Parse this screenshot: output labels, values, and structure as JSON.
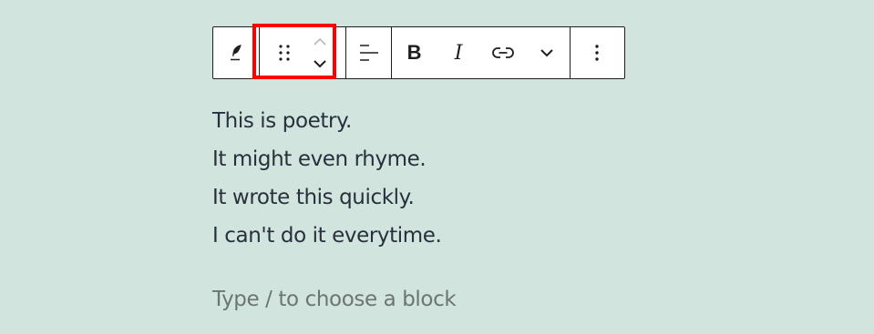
{
  "toolbar": {
    "block_type_icon": "verse-quill-icon",
    "drag_icon": "drag-handle-icon",
    "move_up_icon": "chevron-up-icon",
    "move_down_icon": "chevron-down-icon",
    "align_icon": "align-left-icon",
    "bold_label": "B",
    "italic_label": "I",
    "link_icon": "link-icon",
    "more_formats_icon": "chevron-down-icon",
    "options_icon": "more-vertical-icon"
  },
  "highlight_color": "#ff0000",
  "background_color": "#d1e4dd",
  "poem": {
    "lines": [
      "This is poetry.",
      "It might even rhyme.",
      "It wrote this quickly.",
      "I can't do it everytime."
    ]
  },
  "placeholder": "Type / to choose a block"
}
